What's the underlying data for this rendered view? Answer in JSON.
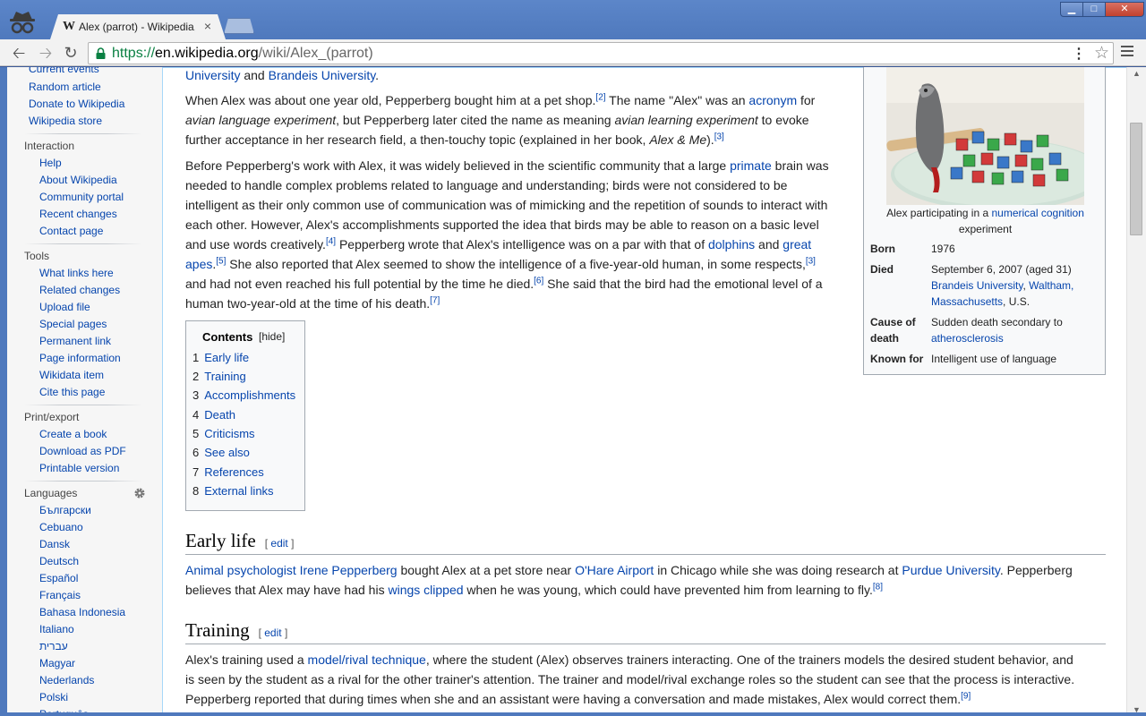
{
  "browser": {
    "tab_favicon": "W",
    "tab_title": "Alex (parrot) - Wikipedia,",
    "tab_close": "×",
    "url_scheme": "https://",
    "url_host": "en.wikipedia.org",
    "url_path": "/wiki/Alex_(parrot)",
    "window_min": "▁",
    "window_max": "□",
    "window_close": "✕"
  },
  "sidebar": {
    "nav": [
      "Current events",
      "Random article",
      "Donate to Wikipedia",
      "Wikipedia store"
    ],
    "interaction_heading": "Interaction",
    "interaction": [
      "Help",
      "About Wikipedia",
      "Community portal",
      "Recent changes",
      "Contact page"
    ],
    "tools_heading": "Tools",
    "tools": [
      "What links here",
      "Related changes",
      "Upload file",
      "Special pages",
      "Permanent link",
      "Page information",
      "Wikidata item",
      "Cite this page"
    ],
    "print_heading": "Print/export",
    "print": [
      "Create a book",
      "Download as PDF",
      "Printable version"
    ],
    "languages_heading": "Languages",
    "languages": [
      "Български",
      "Cebuano",
      "Dansk",
      "Deutsch",
      "Español",
      "Français",
      "Bahasa Indonesia",
      "Italiano",
      "עברית",
      "Magyar",
      "Nederlands",
      "Polski",
      "Português"
    ]
  },
  "article": {
    "intro_end": {
      "link1": "University",
      "and": " and ",
      "link2": "Brandeis University",
      "end": "."
    },
    "p1": {
      "t1": "When Alex was about one year old, Pepperberg bought him at a pet shop.",
      "r1": "[2]",
      "t2": " The name \"Alex\" was an ",
      "l1": "acronym",
      "t3": " for",
      "i1": "avian language experiment",
      "t4": ", but Pepperberg later cited the name as meaning ",
      "i2": "avian learning experiment",
      "t5": " to evoke",
      "t6": "further acceptance in her research field, a then-touchy topic (explained in her book, ",
      "i3": "Alex & Me",
      "t7": ").",
      "r2": "[3]"
    },
    "p2": {
      "a1": "Before Pepperberg's work with Alex, it was widely believed in the scientific community that a large ",
      "l1": "primate",
      "a2": " brain was",
      "b1": "needed to handle complex problems related to language and understanding; birds were not considered to be",
      "c1": "intelligent as their only common use of communication was of mimicking and the repetition of sounds to interact with",
      "d1": "each other. However, Alex's accomplishments supported the idea that birds may be able to reason on a basic level",
      "e1": "and use words creatively.",
      "r1": "[4]",
      "e2": " Pepperberg wrote that Alex's intelligence was on a par with that of ",
      "l2": "dolphins",
      "e3": " and ",
      "l3": "great",
      "f0": "apes",
      "f1": ".",
      "r2": "[5]",
      "f2": " She also reported that Alex seemed to show the intelligence of a five-year-old human, in some respects,",
      "r3": "[3]",
      "g1": "and had not even reached his full potential by the time he died.",
      "r4": "[6]",
      "g2": " She said that the bird had the emotional level of a",
      "h1": "human two-year-old at the time of his death.",
      "r5": "[7]"
    },
    "toc": {
      "title": "Contents",
      "hide": "[hide]",
      "items": [
        {
          "n": "1",
          "label": "Early life"
        },
        {
          "n": "2",
          "label": "Training"
        },
        {
          "n": "3",
          "label": "Accomplishments"
        },
        {
          "n": "4",
          "label": "Death"
        },
        {
          "n": "5",
          "label": "Criticisms"
        },
        {
          "n": "6",
          "label": "See also"
        },
        {
          "n": "7",
          "label": "References"
        },
        {
          "n": "8",
          "label": "External links"
        }
      ]
    },
    "early_life": {
      "heading": "Early life",
      "edit_open": "[ ",
      "edit": "edit",
      "edit_close": " ]",
      "l1": "Animal psychologist",
      "l2": "Irene Pepperberg",
      "t1": " bought Alex at a pet store near ",
      "l3": "O'Hare Airport",
      "t2": " in Chicago while she was doing research at ",
      "l4": "Purdue University",
      "t3": ". Pepperberg",
      "t4": "believes that Alex may have had his ",
      "l5": "wings clipped",
      "t5": " when he was young, which could have prevented him from learning to fly.",
      "r1": "[8]"
    },
    "training": {
      "heading": "Training",
      "edit_open": "[ ",
      "edit": "edit",
      "edit_close": " ]",
      "t1": "Alex's training used a ",
      "l1": "model/rival technique",
      "t2": ", where the student (Alex) observes trainers interacting. One of the trainers models the desired student behavior, and",
      "t3": "is seen by the student as a rival for the other trainer's attention. The trainer and model/rival exchange roles so the student can see that the process is interactive.",
      "t4": "Pepperberg reported that during times when she and an assistant were having a conversation and made mistakes, Alex would correct them.",
      "r1": "[9]"
    }
  },
  "infobox": {
    "caption_t1": "Alex participating in a ",
    "caption_l1": "numerical cognition",
    "caption_t2": "experiment",
    "born_label": "Born",
    "born_value": "1976",
    "died_label": "Died",
    "died_value": "September 6, 2007 (aged 31)",
    "died_l1": "Brandeis University",
    "died_sep": ", ",
    "died_l2": "Waltham,",
    "died_l3": "Massachusetts",
    "died_t3": ", U.S.",
    "cause_label_1": "Cause of",
    "cause_label_2": "death",
    "cause_value": "Sudden death secondary to",
    "cause_link": "atherosclerosis",
    "known_label": "Known for",
    "known_value": "Intelligent use of language"
  }
}
